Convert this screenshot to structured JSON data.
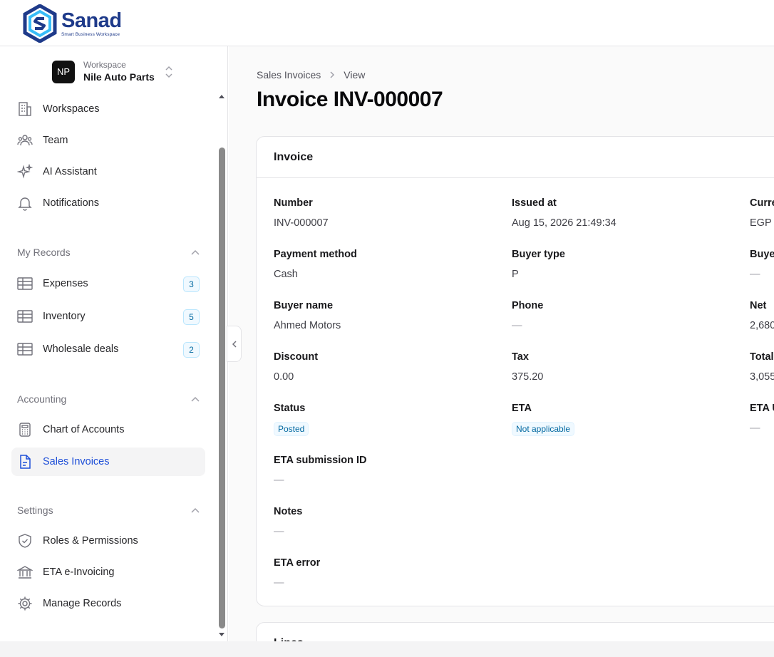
{
  "brand": {
    "name": "Sanad",
    "tagline": "Smart Business Workspace"
  },
  "workspace": {
    "initials": "NP",
    "label": "Workspace",
    "name": "Nile Auto Parts"
  },
  "nav_main": [
    {
      "label": "Workspaces",
      "icon": "building-icon"
    },
    {
      "label": "Team",
      "icon": "users-icon"
    },
    {
      "label": "AI Assistant",
      "icon": "sparkles-icon"
    },
    {
      "label": "Notifications",
      "icon": "bell-icon"
    }
  ],
  "my_records": {
    "title": "My Records",
    "items": [
      {
        "label": "Expenses",
        "count": "3",
        "icon": "table-icon"
      },
      {
        "label": "Inventory",
        "count": "5",
        "icon": "table-icon"
      },
      {
        "label": "Wholesale deals",
        "count": "2",
        "icon": "table-icon"
      }
    ]
  },
  "accounting": {
    "title": "Accounting",
    "items": [
      {
        "label": "Chart of Accounts",
        "icon": "calculator-icon"
      },
      {
        "label": "Sales Invoices",
        "icon": "file-text-icon",
        "active": true
      }
    ]
  },
  "settings": {
    "title": "Settings",
    "items": [
      {
        "label": "Roles & Permissions",
        "icon": "shield-check-icon"
      },
      {
        "label": "ETA e-Invoicing",
        "icon": "landmark-icon"
      },
      {
        "label": "Manage Records",
        "icon": "gear-icon"
      }
    ]
  },
  "breadcrumb": {
    "parent": "Sales Invoices",
    "current": "View"
  },
  "page_title": "Invoice INV-000007",
  "invoice_card": {
    "title": "Invoice",
    "fields": {
      "number": {
        "label": "Number",
        "value": "INV-000007"
      },
      "issued_at": {
        "label": "Issued at",
        "value": "Aug 15, 2026 21:49:34"
      },
      "currency": {
        "label": "Curre",
        "value": "EGP"
      },
      "payment_method": {
        "label": "Payment method",
        "value": "Cash"
      },
      "buyer_type": {
        "label": "Buyer type",
        "value": "P"
      },
      "buyer_id": {
        "label": "Buye",
        "value": "—"
      },
      "buyer_name": {
        "label": "Buyer name",
        "value": "Ahmed Motors"
      },
      "phone": {
        "label": "Phone",
        "value": "—"
      },
      "net": {
        "label": "Net",
        "value": "2,680"
      },
      "discount": {
        "label": "Discount",
        "value": "0.00"
      },
      "tax": {
        "label": "Tax",
        "value": "375.20"
      },
      "total": {
        "label": "Total",
        "value": "3,055"
      },
      "status": {
        "label": "Status",
        "value": "Posted"
      },
      "eta": {
        "label": "ETA",
        "value": "Not applicable"
      },
      "eta_uuid": {
        "label": "ETA U",
        "value": "—"
      },
      "eta_submission_id": {
        "label": "ETA submission ID",
        "value": "—"
      },
      "notes": {
        "label": "Notes",
        "value": "—"
      },
      "eta_error": {
        "label": "ETA error",
        "value": "—"
      }
    }
  },
  "lines_card": {
    "title": "Lines"
  },
  "colors": {
    "brand": "#1e3a8a",
    "accent": "#1d4ed8",
    "badge_text": "#0369a1",
    "badge_bg": "#f0f9ff"
  }
}
